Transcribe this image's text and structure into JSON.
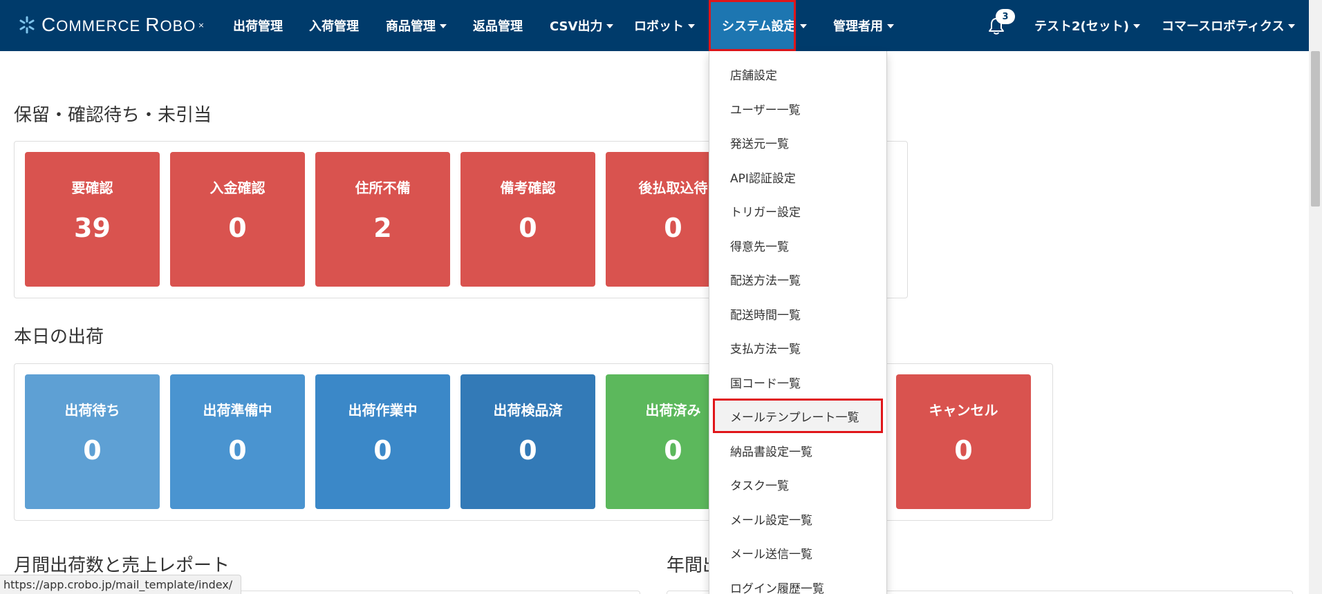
{
  "navbar": {
    "brand": {
      "first_big": "C",
      "first_rest": "OMMERCE ",
      "second_big": "R",
      "second_rest": "OBO",
      "star": "×"
    },
    "items": [
      {
        "label": "出荷管理",
        "dropdown": false
      },
      {
        "label": "入荷管理",
        "dropdown": false
      },
      {
        "label": "商品管理",
        "dropdown": true
      },
      {
        "label": "返品管理",
        "dropdown": false
      },
      {
        "label": "CSV出力",
        "dropdown": true
      },
      {
        "label": "ロボット",
        "dropdown": true
      },
      {
        "label": "システム設定",
        "dropdown": true,
        "active": true
      },
      {
        "label": "管理者用",
        "dropdown": true
      }
    ],
    "notifications": {
      "count": "3"
    },
    "user_label": "テスト2(セット)",
    "company_label": "コマースロボティクス"
  },
  "sections": {
    "pending": {
      "title": "保留・確認待ち・未引当",
      "tiles": [
        {
          "label": "要確認",
          "value": "39"
        },
        {
          "label": "入金確認",
          "value": "0"
        },
        {
          "label": "住所不備",
          "value": "2"
        },
        {
          "label": "備考確認",
          "value": "0"
        },
        {
          "label": "後払取込待",
          "value": "0"
        }
      ]
    },
    "today": {
      "title": "本日の出荷",
      "tiles": [
        {
          "label": "出荷待ち",
          "value": "0"
        },
        {
          "label": "出荷準備中",
          "value": "0"
        },
        {
          "label": "出荷作業中",
          "value": "0"
        },
        {
          "label": "出荷検品済",
          "value": "0"
        },
        {
          "label": "出荷済み",
          "value": "0"
        },
        {
          "label": "キャンセル",
          "value": "0"
        }
      ]
    },
    "monthly_report": {
      "title": "月間出荷数と売上レポート"
    },
    "annual_report": {
      "title": "年間出"
    }
  },
  "dropdown": {
    "items": [
      "店舗設定",
      "ユーザー一覧",
      "発送元一覧",
      "API認証設定",
      "トリガー設定",
      "得意先一覧",
      "配送方法一覧",
      "配送時間一覧",
      "支払方法一覧",
      "国コード一覧",
      "メールテンプレート一覧",
      "納品書設定一覧",
      "タスク一覧",
      "メール設定一覧",
      "メール送信一覧",
      "ログイン履歴一覧"
    ],
    "highlighted_index": 10
  },
  "status_bar": {
    "url": "https://app.crobo.jp/mail_template/index/"
  },
  "colors": {
    "navbar": "#003b6b",
    "active_nav": "#1d76b1",
    "highlight_border": "#e0161a",
    "tile_red": "#d9534f",
    "tile_green": "#5cb85c",
    "tile_blue": "#337ab7"
  }
}
